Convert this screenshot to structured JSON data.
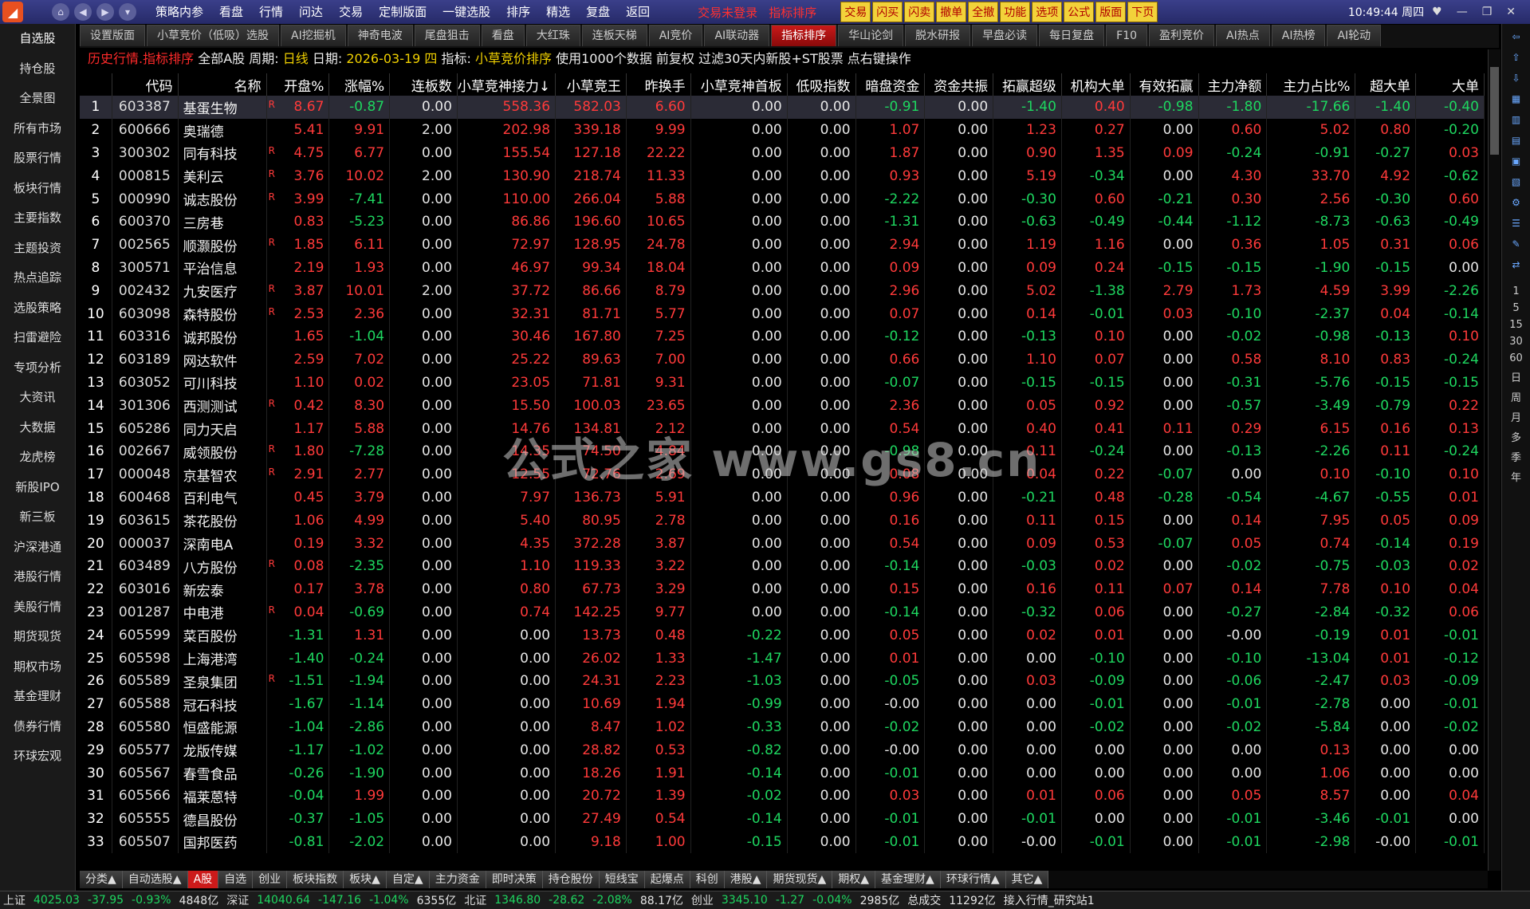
{
  "window": {
    "clock": "10:49:44 周四"
  },
  "menu": [
    "策略内参",
    "看盘",
    "行情",
    "问达",
    "交易",
    "定制版面",
    "一键选股",
    "排序",
    "精选",
    "复盘",
    "返回"
  ],
  "login": {
    "trade_login": "交易未登录",
    "indicator_sort": "指标排序"
  },
  "quick_buttons": [
    "交易",
    "闪买",
    "闪卖",
    "撤单",
    "全撤",
    "功能",
    "选项",
    "公式",
    "版面",
    "下页"
  ],
  "left_nav": [
    "自选股",
    "持仓股",
    "全景图",
    "所有市场",
    "股票行情",
    "板块行情",
    "主要指数",
    "主题投资",
    "热点追踪",
    "选股策略",
    "扫雷避险",
    "专项分析",
    "大资讯",
    "大数据",
    "龙虎榜",
    "新股IPO",
    "新三板",
    "沪深港通",
    "港股行情",
    "美股行情",
    "期货现货",
    "期权市场",
    "基金理财",
    "债券行情",
    "环球宏观"
  ],
  "tabs": [
    "设置版面",
    "小草竞价（低吸）选股",
    "AI挖掘机",
    "神奇电波",
    "尾盘狙击",
    "看盘",
    "大红珠",
    "连板天梯",
    "AI竞价",
    "AI联动器",
    "指标排序",
    "华山论剑",
    "脱水研报",
    "早盘必读",
    "每日复盘",
    "F10",
    "盈利竞价",
    "AI热点",
    "AI热榜",
    "AI轮动"
  ],
  "selected_tab": "指标排序",
  "info": {
    "p1": "历史行情.指标排序",
    "p2": "全部A股",
    "p3": "周期:",
    "p4": "日线",
    "p5": "日期:",
    "p6": "2026-03-19 四",
    "p7": "指标:",
    "p8": "小草竞价排序",
    "p9": "使用1000个数据  前复权  过滤30天内新股+ST股票  点右键操作"
  },
  "columns": [
    "",
    "代码",
    "名称",
    "开盘%",
    "涨幅%",
    "连板数",
    "小草竞神接力↓",
    "小草竞王",
    "昨换手",
    "小草竞神首板",
    "低吸指数",
    "暗盘资金",
    "资金共振",
    "拓赢超级",
    "机构大单",
    "有效拓赢",
    "主力净额",
    "主力占比%",
    "超大单",
    "大单"
  ],
  "rows": [
    [
      "1",
      "603387",
      "基蛋生物",
      "R",
      "8.67",
      "-0.87",
      "0.00",
      "558.36",
      "582.03",
      "6.60",
      "0.00",
      "0.00",
      "-0.91",
      "0.00",
      "-1.40",
      "0.40",
      "-0.98",
      "-1.80",
      "-17.66",
      "-1.40",
      "-0.40"
    ],
    [
      "2",
      "600666",
      "奥瑞德",
      "",
      "5.41",
      "9.91",
      "2.00",
      "202.98",
      "339.18",
      "9.99",
      "0.00",
      "0.00",
      "1.07",
      "0.00",
      "1.23",
      "0.27",
      "0.00",
      "0.60",
      "5.02",
      "0.80",
      "-0.20"
    ],
    [
      "3",
      "300302",
      "同有科技",
      "R",
      "4.75",
      "6.77",
      "0.00",
      "155.54",
      "127.18",
      "22.22",
      "0.00",
      "0.00",
      "1.87",
      "0.00",
      "0.90",
      "1.35",
      "0.09",
      "-0.24",
      "-0.91",
      "-0.27",
      "0.03"
    ],
    [
      "4",
      "000815",
      "美利云",
      "R",
      "3.76",
      "10.02",
      "2.00",
      "130.90",
      "218.74",
      "11.33",
      "0.00",
      "0.00",
      "0.93",
      "0.00",
      "5.19",
      "-0.34",
      "0.00",
      "4.30",
      "33.70",
      "4.92",
      "-0.62"
    ],
    [
      "5",
      "000990",
      "诚志股份",
      "R",
      "3.99",
      "-7.41",
      "0.00",
      "110.00",
      "266.04",
      "5.88",
      "0.00",
      "0.00",
      "-2.22",
      "0.00",
      "-0.30",
      "0.60",
      "-0.21",
      "0.30",
      "2.56",
      "-0.30",
      "0.60"
    ],
    [
      "6",
      "600370",
      "三房巷",
      "",
      "0.83",
      "-5.23",
      "0.00",
      "86.86",
      "196.60",
      "10.65",
      "0.00",
      "0.00",
      "-1.31",
      "0.00",
      "-0.63",
      "-0.49",
      "-0.44",
      "-1.12",
      "-8.73",
      "-0.63",
      "-0.49"
    ],
    [
      "7",
      "002565",
      "顺灏股份",
      "R",
      "1.85",
      "6.11",
      "0.00",
      "72.97",
      "128.95",
      "24.78",
      "0.00",
      "0.00",
      "2.94",
      "0.00",
      "1.19",
      "1.16",
      "0.00",
      "0.36",
      "1.05",
      "0.31",
      "0.06"
    ],
    [
      "8",
      "300571",
      "平治信息",
      "",
      "2.19",
      "1.93",
      "0.00",
      "46.97",
      "99.34",
      "18.04",
      "0.00",
      "0.00",
      "0.09",
      "0.00",
      "0.09",
      "0.24",
      "-0.15",
      "-0.15",
      "-1.90",
      "-0.15",
      "0.00"
    ],
    [
      "9",
      "002432",
      "九安医疗",
      "R",
      "3.87",
      "10.01",
      "2.00",
      "37.72",
      "86.66",
      "8.79",
      "0.00",
      "0.00",
      "2.96",
      "0.00",
      "5.02",
      "-1.38",
      "2.79",
      "1.73",
      "4.59",
      "3.99",
      "-2.26"
    ],
    [
      "10",
      "603098",
      "森特股份",
      "R",
      "2.53",
      "2.36",
      "0.00",
      "32.31",
      "81.71",
      "5.77",
      "0.00",
      "0.00",
      "0.07",
      "0.00",
      "0.14",
      "-0.01",
      "0.03",
      "-0.10",
      "-2.37",
      "0.04",
      "-0.14"
    ],
    [
      "11",
      "603316",
      "诚邦股份",
      "",
      "1.65",
      "-1.04",
      "0.00",
      "30.46",
      "167.80",
      "7.25",
      "0.00",
      "0.00",
      "-0.12",
      "0.00",
      "-0.13",
      "0.10",
      "0.00",
      "-0.02",
      "-0.98",
      "-0.13",
      "0.10"
    ],
    [
      "12",
      "603189",
      "网达软件",
      "",
      "2.59",
      "7.02",
      "0.00",
      "25.22",
      "89.63",
      "7.00",
      "0.00",
      "0.00",
      "0.66",
      "0.00",
      "1.10",
      "0.07",
      "0.00",
      "0.58",
      "8.10",
      "0.83",
      "-0.24"
    ],
    [
      "13",
      "603052",
      "可川科技",
      "",
      "1.10",
      "0.02",
      "0.00",
      "23.05",
      "71.81",
      "9.31",
      "0.00",
      "0.00",
      "-0.07",
      "0.00",
      "-0.15",
      "-0.15",
      "0.00",
      "-0.31",
      "-5.76",
      "-0.15",
      "-0.15"
    ],
    [
      "14",
      "301306",
      "西测测试",
      "R",
      "0.42",
      "8.30",
      "0.00",
      "15.50",
      "100.03",
      "23.65",
      "0.00",
      "0.00",
      "2.36",
      "0.00",
      "0.05",
      "0.92",
      "0.00",
      "-0.57",
      "-3.49",
      "-0.79",
      "0.22"
    ],
    [
      "15",
      "605286",
      "同力天启",
      "",
      "1.17",
      "5.88",
      "0.00",
      "14.76",
      "134.81",
      "2.12",
      "0.00",
      "0.00",
      "0.54",
      "0.00",
      "0.40",
      "0.41",
      "0.11",
      "0.29",
      "6.15",
      "0.16",
      "0.13"
    ],
    [
      "16",
      "002667",
      "威领股份",
      "R",
      "1.80",
      "-7.28",
      "0.00",
      "14.35",
      "74.50",
      "4.84",
      "0.00",
      "0.00",
      "-0.98",
      "0.00",
      "0.11",
      "-0.24",
      "0.00",
      "-0.13",
      "-2.26",
      "0.11",
      "-0.24"
    ],
    [
      "17",
      "000048",
      "京基智农",
      "R",
      "2.91",
      "2.77",
      "0.00",
      "12.55",
      "72.76",
      "2.69",
      "0.00",
      "0.00",
      "0.08",
      "0.00",
      "0.04",
      "0.22",
      "-0.07",
      "0.00",
      "0.10",
      "-0.10",
      "0.10"
    ],
    [
      "18",
      "600468",
      "百利电气",
      "",
      "0.45",
      "3.79",
      "0.00",
      "7.97",
      "136.73",
      "5.91",
      "0.00",
      "0.00",
      "0.96",
      "0.00",
      "-0.21",
      "0.48",
      "-0.28",
      "-0.54",
      "-4.67",
      "-0.55",
      "0.01"
    ],
    [
      "19",
      "603615",
      "茶花股份",
      "",
      "1.06",
      "4.99",
      "0.00",
      "5.40",
      "80.95",
      "2.78",
      "0.00",
      "0.00",
      "0.16",
      "0.00",
      "0.11",
      "0.15",
      "0.00",
      "0.14",
      "7.95",
      "0.05",
      "0.09"
    ],
    [
      "20",
      "000037",
      "深南电A",
      "",
      "0.19",
      "3.32",
      "0.00",
      "4.35",
      "372.28",
      "3.87",
      "0.00",
      "0.00",
      "0.54",
      "0.00",
      "0.09",
      "0.53",
      "-0.07",
      "0.05",
      "0.74",
      "-0.14",
      "0.19"
    ],
    [
      "21",
      "603489",
      "八方股份",
      "R",
      "0.08",
      "-2.35",
      "0.00",
      "1.10",
      "119.33",
      "3.22",
      "0.00",
      "0.00",
      "-0.14",
      "0.00",
      "-0.03",
      "0.02",
      "0.00",
      "-0.02",
      "-0.75",
      "-0.03",
      "0.02"
    ],
    [
      "22",
      "603016",
      "新宏泰",
      "",
      "0.17",
      "3.78",
      "0.00",
      "0.80",
      "67.73",
      "3.29",
      "0.00",
      "0.00",
      "0.15",
      "0.00",
      "0.16",
      "0.11",
      "0.07",
      "0.14",
      "7.78",
      "0.10",
      "0.04"
    ],
    [
      "23",
      "001287",
      "中电港",
      "R",
      "0.04",
      "-0.69",
      "0.00",
      "0.74",
      "142.25",
      "9.77",
      "0.00",
      "0.00",
      "-0.14",
      "0.00",
      "-0.32",
      "0.06",
      "0.00",
      "-0.27",
      "-2.84",
      "-0.32",
      "0.06"
    ],
    [
      "24",
      "605599",
      "菜百股份",
      "",
      "-1.31",
      "1.31",
      "0.00",
      "0.00",
      "13.73",
      "0.48",
      "-0.22",
      "0.00",
      "0.05",
      "0.00",
      "0.02",
      "0.01",
      "0.00",
      "-0.00",
      "-0.19",
      "0.01",
      "-0.01"
    ],
    [
      "25",
      "605598",
      "上海港湾",
      "",
      "-1.40",
      "-0.24",
      "0.00",
      "0.00",
      "26.02",
      "1.33",
      "-1.47",
      "0.00",
      "0.01",
      "0.00",
      "0.00",
      "-0.10",
      "0.00",
      "-0.10",
      "-13.04",
      "0.01",
      "-0.12"
    ],
    [
      "26",
      "605589",
      "圣泉集团",
      "R",
      "-1.51",
      "-1.94",
      "0.00",
      "0.00",
      "24.31",
      "2.23",
      "-1.03",
      "0.00",
      "-0.05",
      "0.00",
      "0.03",
      "-0.09",
      "0.00",
      "-0.06",
      "-2.47",
      "0.03",
      "-0.09"
    ],
    [
      "27",
      "605588",
      "冠石科技",
      "",
      "-1.67",
      "-1.14",
      "0.00",
      "0.00",
      "10.69",
      "1.94",
      "-0.99",
      "0.00",
      "-0.00",
      "0.00",
      "0.00",
      "-0.01",
      "0.00",
      "-0.01",
      "-2.78",
      "0.00",
      "-0.01"
    ],
    [
      "28",
      "605580",
      "恒盛能源",
      "",
      "-1.04",
      "-2.86",
      "0.00",
      "0.00",
      "8.47",
      "1.02",
      "-0.33",
      "0.00",
      "-0.02",
      "0.00",
      "0.00",
      "-0.02",
      "0.00",
      "-0.02",
      "-5.84",
      "0.00",
      "-0.02"
    ],
    [
      "29",
      "605577",
      "龙版传媒",
      "",
      "-1.17",
      "-1.02",
      "0.00",
      "0.00",
      "28.82",
      "0.53",
      "-0.82",
      "0.00",
      "-0.00",
      "0.00",
      "0.00",
      "0.00",
      "0.00",
      "0.00",
      "0.13",
      "0.00",
      "0.00"
    ],
    [
      "30",
      "605567",
      "春雪食品",
      "",
      "-0.26",
      "-1.90",
      "0.00",
      "0.00",
      "18.26",
      "1.91",
      "-0.14",
      "0.00",
      "-0.01",
      "0.00",
      "0.00",
      "0.00",
      "0.00",
      "0.00",
      "1.06",
      "0.00",
      "0.00"
    ],
    [
      "31",
      "605566",
      "福莱蒽特",
      "",
      "-0.04",
      "1.99",
      "0.00",
      "0.00",
      "20.72",
      "1.39",
      "-0.02",
      "0.00",
      "0.03",
      "0.00",
      "0.01",
      "0.06",
      "0.00",
      "0.05",
      "8.57",
      "0.00",
      "0.04"
    ],
    [
      "32",
      "605555",
      "德昌股份",
      "",
      "-0.37",
      "-1.05",
      "0.00",
      "0.00",
      "27.49",
      "0.54",
      "-0.14",
      "0.00",
      "-0.01",
      "0.00",
      "-0.01",
      "0.00",
      "0.00",
      "-0.01",
      "-3.46",
      "-0.01",
      "0.00"
    ],
    [
      "33",
      "605507",
      "国邦医药",
      "",
      "-0.81",
      "-2.02",
      "0.00",
      "0.00",
      "9.18",
      "1.00",
      "-0.15",
      "0.00",
      "-0.01",
      "0.00",
      "-0.00",
      "-0.01",
      "0.00",
      "-0.01",
      "-2.98",
      "-0.00",
      "-0.01"
    ]
  ],
  "watermark": "公式之家 www.gs8.cn",
  "bottom_tabs": [
    "分类▲",
    "自动选股▲",
    "A股",
    "自选",
    "创业",
    "板块指数",
    "板块▲",
    "自定▲",
    "主力资金",
    "即时决策",
    "持仓股份",
    "短线宝",
    "起爆点",
    "科创",
    "港股▲",
    "期货现货▲",
    "期权▲",
    "基金理财▲",
    "环球行情▲",
    "其它▲"
  ],
  "bottom_selected": "A股",
  "right_bar_numbers": [
    "1",
    "5",
    "15",
    "30",
    "60",
    "日",
    "周",
    "月",
    "多",
    "季",
    "年"
  ],
  "status": {
    "sh": "上证",
    "sh_val": "4025.03",
    "sh_chg": "-37.95",
    "sh_pct": "-0.93%",
    "sh_amt": "4848亿",
    "sz": "深证",
    "sz_val": "14040.64",
    "sz_chg": "-147.16",
    "sz_pct": "-1.04%",
    "sz_amt": "6355亿",
    "bz": "北证",
    "bz_val": "1346.80",
    "bz_chg": "-28.62",
    "bz_pct": "-2.08%",
    "bz_amt": "88.17亿",
    "cy": "创业",
    "cy_val": "3345.10",
    "cy_chg": "-1.27",
    "cy_pct": "-0.04%",
    "cy_amt": "2985亿",
    "total": "总成交",
    "total_amt": "11292亿",
    "access": "接入行情_研究站1"
  }
}
